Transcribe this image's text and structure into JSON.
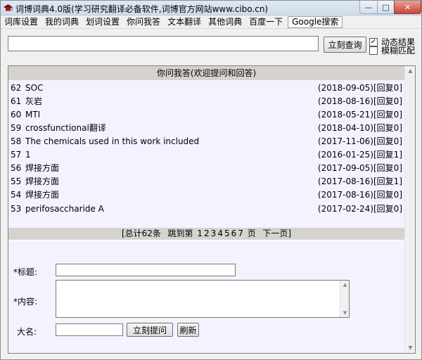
{
  "window": {
    "title": "词博词典4.0版(学习研究翻译必备软件,词博官方网站www.cibo.cn)"
  },
  "menu": [
    "词库设置",
    "我的词典",
    "划词设置",
    "你问我答",
    "文本翻译",
    "其他词典",
    "百度一下",
    "Google搜索"
  ],
  "search": {
    "value": "",
    "query_button": "立刻查询",
    "dynamic_label": "动态结果",
    "dynamic_checked": true,
    "fuzzy_label": "模糊匹配",
    "fuzzy_checked": false
  },
  "qa": {
    "header": "你问我答(欢迎提问和回答)",
    "items": [
      {
        "num": "62",
        "question": "SOC",
        "date": "(2018-09-05)",
        "replies": "[回复0]"
      },
      {
        "num": "61",
        "question": "灰岩",
        "date": "(2018-08-16)",
        "replies": "[回复0]"
      },
      {
        "num": "60",
        "question": "MTI",
        "date": "(2018-05-21)",
        "replies": "[回复0]"
      },
      {
        "num": "59",
        "question": "crossfunctional翻译",
        "date": "(2018-04-10)",
        "replies": "[回复0]"
      },
      {
        "num": "58",
        "question": "The chemicals used in this work included",
        "date": "(2017-11-06)",
        "replies": "[回复0]"
      },
      {
        "num": "57",
        "question": "1",
        "date": "(2016-01-25)",
        "replies": "[回复1]"
      },
      {
        "num": "56",
        "question": "焊接方面",
        "date": "(2017-09-05)",
        "replies": "[回复0]"
      },
      {
        "num": "55",
        "question": "焊接方面",
        "date": "(2017-08-16)",
        "replies": "[回复1]"
      },
      {
        "num": "54",
        "question": "焊接方面",
        "date": "(2017-08-16)",
        "replies": "[回复0]"
      },
      {
        "num": "53",
        "question": "perifosaccharide A",
        "date": "(2017-02-24)",
        "replies": "[回复0]"
      }
    ],
    "pager": {
      "total": "[总计62条",
      "goto": "跳到第",
      "pages": [
        "1",
        "2",
        "3",
        "4",
        "5",
        "6",
        "7"
      ],
      "page_unit": "页",
      "next": "下一页]"
    }
  },
  "form": {
    "title_label": "*标题:",
    "title_value": "",
    "content_label": "*内容:",
    "content_value": "",
    "name_label": "大名:",
    "name_value": "",
    "submit_button": "立刻提问",
    "refresh_button": "刷新"
  }
}
